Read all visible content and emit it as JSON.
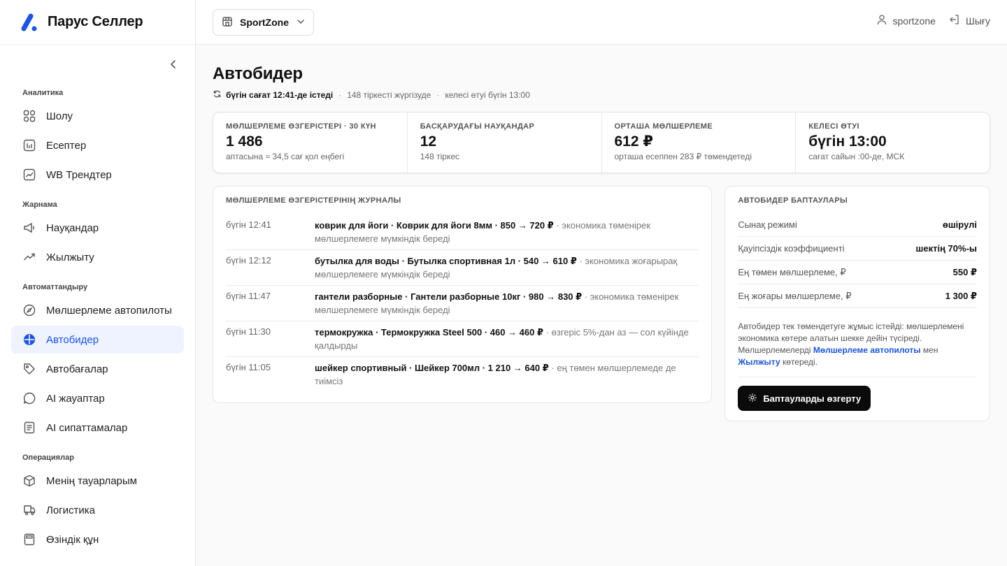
{
  "brand": {
    "name": "Парус Селлер",
    "accent": "#1a55e6"
  },
  "sidebar": {
    "groups": [
      {
        "title": "Аналитика",
        "items": [
          {
            "label": "Шолу",
            "icon": "grid-icon"
          },
          {
            "label": "Есептер",
            "icon": "report-icon"
          },
          {
            "label": "WB Трендтер",
            "icon": "trend-chart-icon"
          }
        ]
      },
      {
        "title": "Жарнама",
        "items": [
          {
            "label": "Науқандар",
            "icon": "megaphone-icon"
          },
          {
            "label": "Жылжыту",
            "icon": "trending-up-icon"
          }
        ]
      },
      {
        "title": "Автоматтандыру",
        "items": [
          {
            "label": "Мөлшерлеме автопилоты",
            "icon": "compass-icon"
          },
          {
            "label": "Автобидер",
            "icon": "autobidder-icon",
            "active": true
          },
          {
            "label": "Автобағалар",
            "icon": "tag-icon"
          },
          {
            "label": "AI жауаптар",
            "icon": "chat-icon"
          },
          {
            "label": "AI сипаттамалар",
            "icon": "document-icon"
          }
        ]
      },
      {
        "title": "Операциялар",
        "items": [
          {
            "label": "Менің тауарларым",
            "icon": "box-icon"
          },
          {
            "label": "Логистика",
            "icon": "truck-icon"
          },
          {
            "label": "Өзіндік құн",
            "icon": "calculator-icon"
          }
        ]
      }
    ]
  },
  "header": {
    "store": "SportZone",
    "user": "sportzone",
    "logout": "Шығу"
  },
  "page": {
    "title": "Автобидер",
    "status_ran": "бүгін сағат 12:41-де істеді",
    "status_active": "148 тіркесті жүргізуде",
    "status_next": "келесі өтуі бүгін 13:00",
    "stats": [
      {
        "label": "МӨЛШЕРЛЕМЕ ӨЗГЕРІСТЕРІ · 30 КҮН",
        "value": "1 486",
        "sub": "аптасына ≈ 34,5 сағ қол еңбегі"
      },
      {
        "label": "БАСҚАРУДАҒЫ НАУҚАНДАР",
        "value": "12",
        "sub": "148 тіркес"
      },
      {
        "label": "ОРТАША МӨЛШЕРЛЕМЕ",
        "value": "612 ₽",
        "sub": "орташа есеппен 283 ₽ төмендетеді"
      },
      {
        "label": "КЕЛЕСІ ӨТУІ",
        "value": "бүгін 13:00",
        "sub": "сағат сайын :00-де, МСК"
      }
    ]
  },
  "journal": {
    "title": "МӨЛШЕРЛЕМЕ ӨЗГЕРІСТЕРІНІҢ ЖУРНАЛЫ",
    "rows": [
      {
        "time": "бүгін 12:41",
        "main": "коврик для йоги · Коврик для йоги 8мм · 850 → 720 ₽",
        "note": " · экономика төменірек мөлшерлемеге мүмкіндік береді"
      },
      {
        "time": "бүгін 12:12",
        "main": "бутылка для воды · Бутылка спортивная 1л · 540 → 610 ₽",
        "note": " · экономика жоғарырақ мөлшерлемеге мүмкіндік береді"
      },
      {
        "time": "бүгін 11:47",
        "main": "гантели разборные · Гантели разборные 10кг · 980 → 830 ₽",
        "note": " · экономика төменірек мөлшерлемеге мүмкіндік береді"
      },
      {
        "time": "бүгін 11:30",
        "main": "термокружка · Термокружка Steel 500 · 460 → 460 ₽",
        "note": " · өзгеріс 5%-дан аз — сол күйінде қалдырды"
      },
      {
        "time": "бүгін 11:05",
        "main": "шейкер спортивный · Шейкер 700мл · 1 210 → 640 ₽",
        "note": " · ең төмен мөлшерлемеде де тиімсіз"
      }
    ]
  },
  "settings": {
    "title": "АВТОБИДЕР БАПТАУЛАРЫ",
    "rows": [
      {
        "label": "Сынақ режимі",
        "value": "өшірулі"
      },
      {
        "label": "Қауіпсіздік коэффициенті",
        "value": "шектің 70%-ы"
      },
      {
        "label": "Ең төмен мөлшерлеме, ₽",
        "value": "550 ₽"
      },
      {
        "label": "Ең жоғары мөлшерлеме, ₽",
        "value": "1 300 ₽"
      }
    ],
    "note_1": "Автобидер тек төмендетуге жұмыс істейді: мөлшерлемені экономика көтере алатын шекке дейін түсіреді. Мөлшерлемелерді ",
    "note_link_1": "Мөлшерлеме автопилоты",
    "note_2": " мен ",
    "note_link_2": "Жылжыту",
    "note_3": " көтереді.",
    "button": "Баптауларды өзгерту"
  }
}
